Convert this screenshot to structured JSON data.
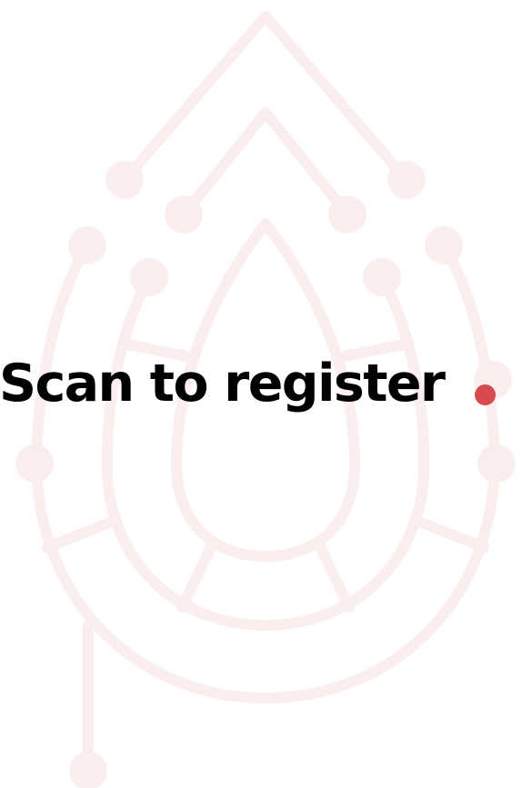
{
  "headline": {
    "text": "Scan to register"
  },
  "colors": {
    "accent": "#d94a4e",
    "watermark": "#fbeeee",
    "text": "#000000",
    "background": "#ffffff"
  },
  "icons": {
    "watermark": "drop-circuit-logo-icon",
    "accent": "dot-icon"
  }
}
